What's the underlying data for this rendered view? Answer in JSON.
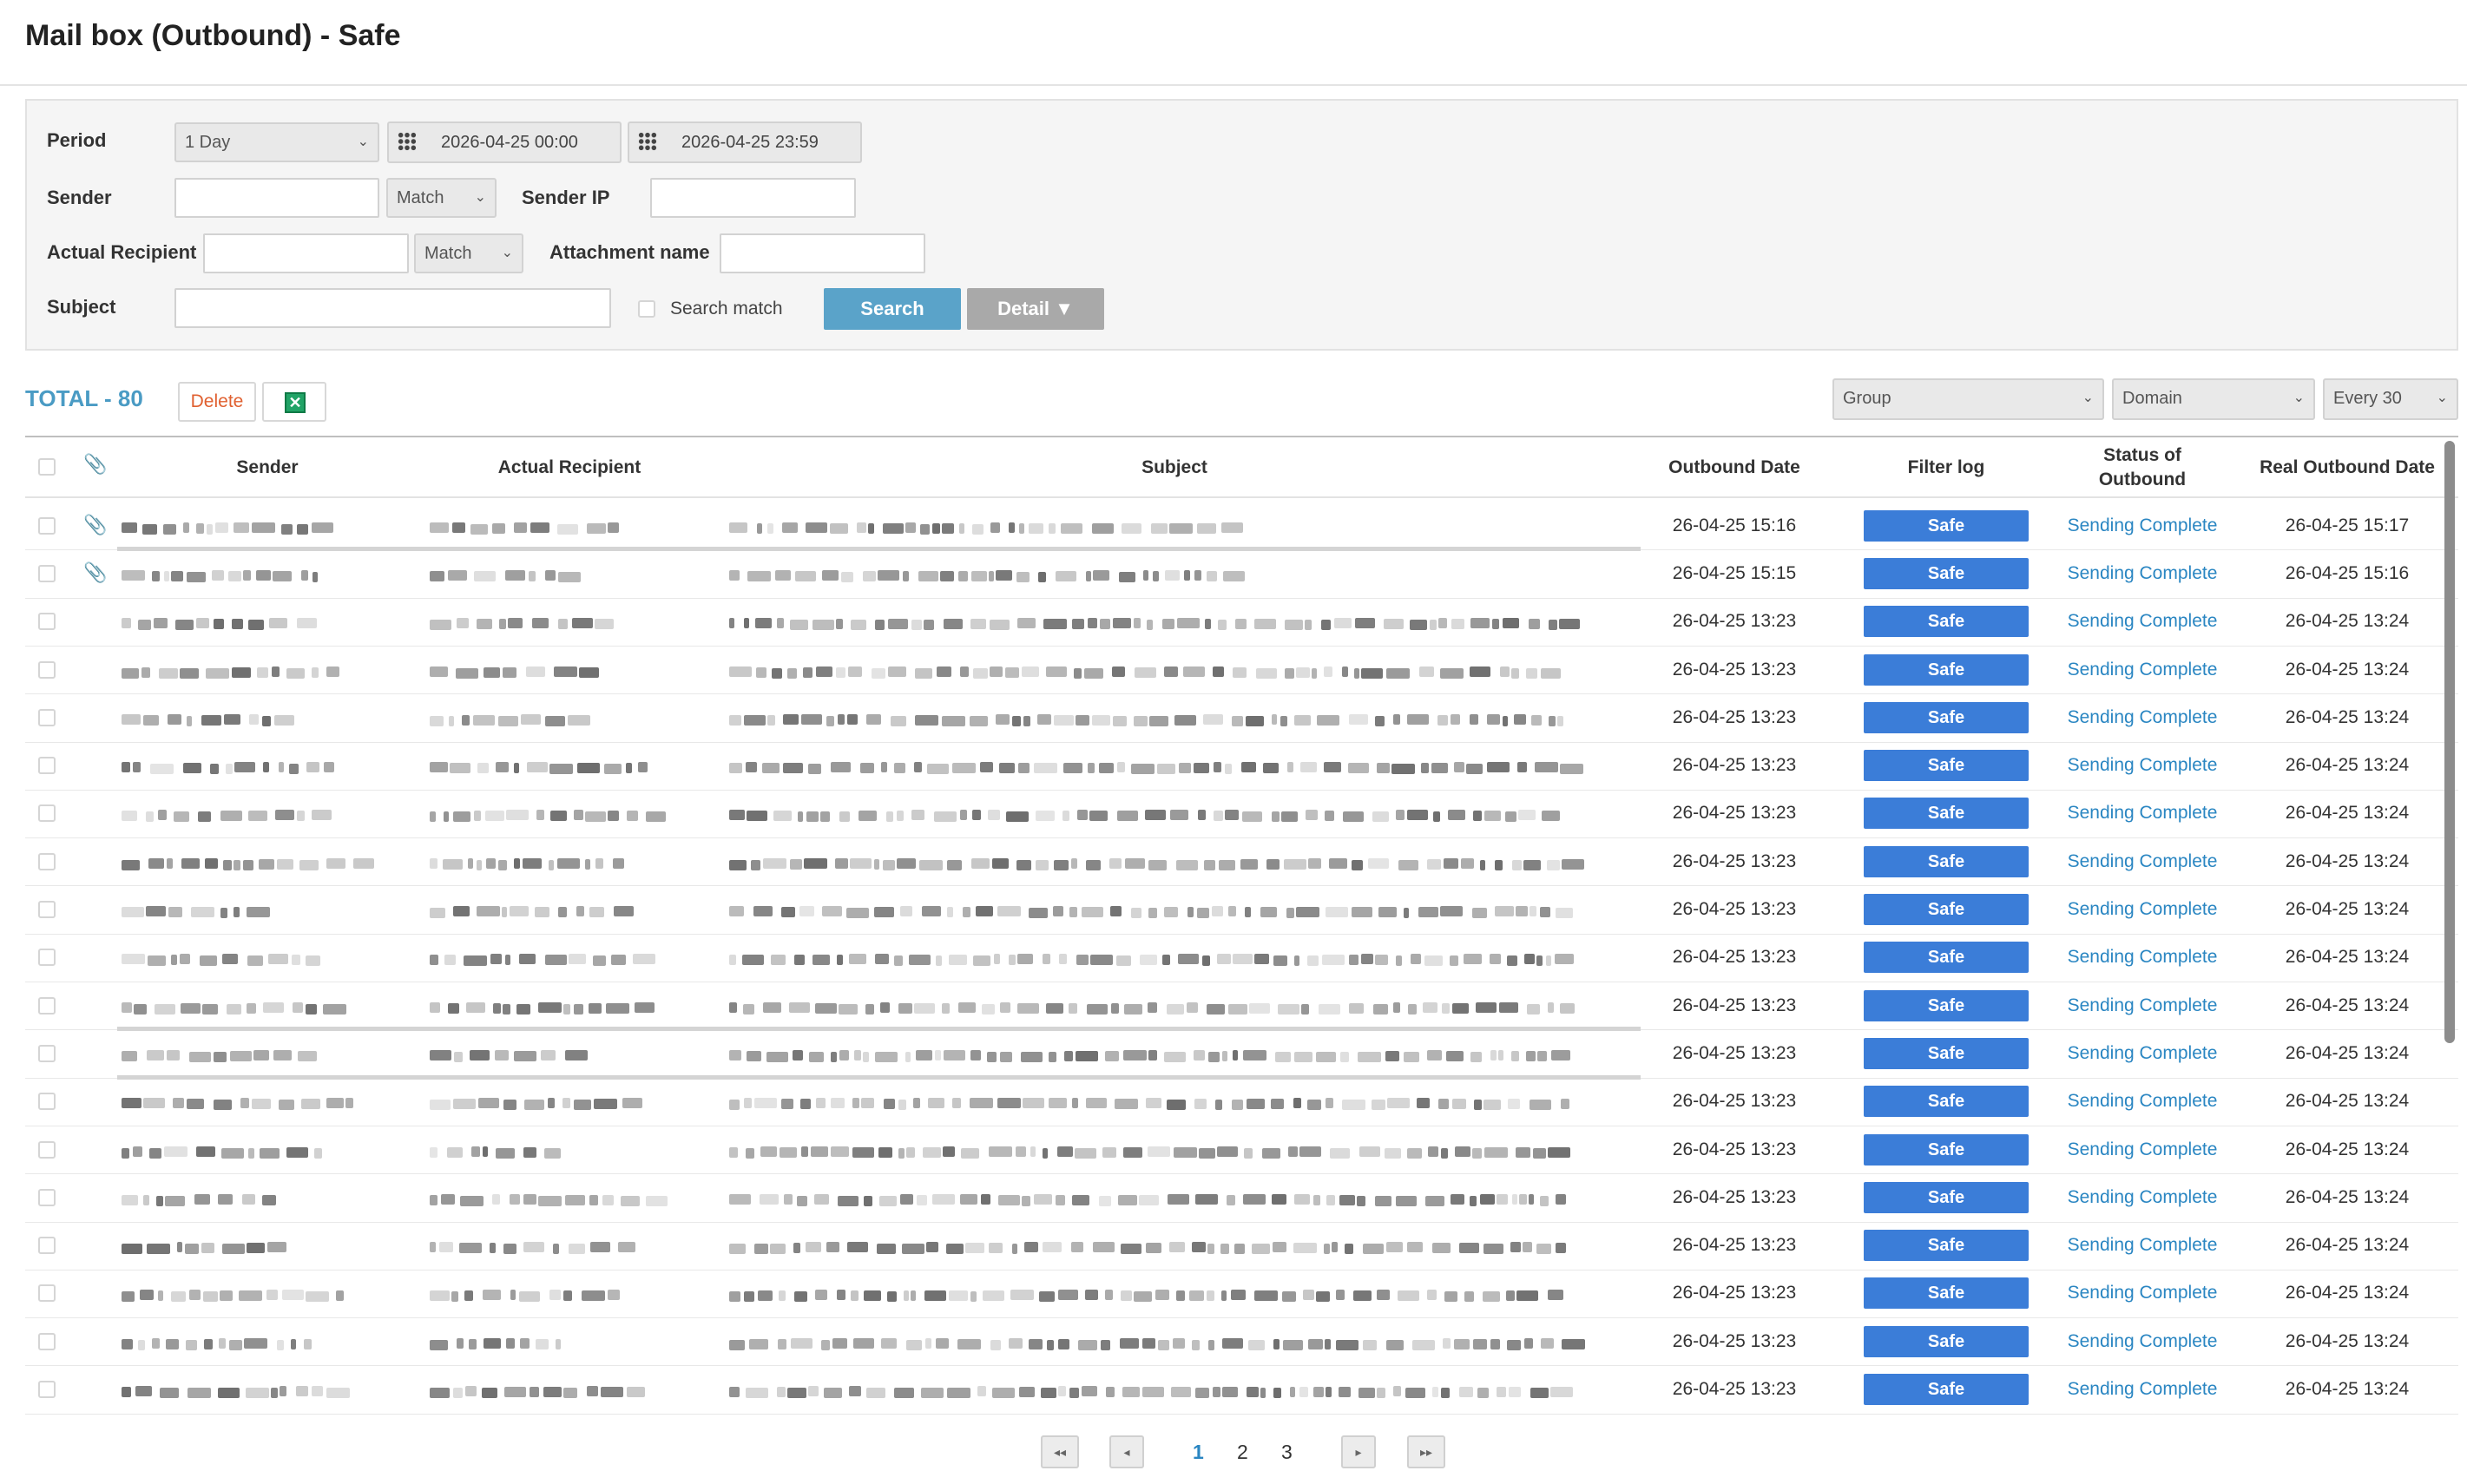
{
  "title": "Mail box (Outbound) - Safe",
  "filters": {
    "period_label": "Period",
    "period_value": "1 Day",
    "date_from": "2026-04-25 00:00",
    "date_to": "2026-04-25 23:59",
    "sender_label": "Sender",
    "sender_match": "Match",
    "sender_ip_label": "Sender IP",
    "recipient_label": "Actual Recipient",
    "recipient_match": "Match",
    "attachment_label": "Attachment name",
    "subject_label": "Subject",
    "search_match_label": "Search match",
    "search_button": "Search",
    "detail_button": "Detail ▼"
  },
  "toolbar": {
    "total": "TOTAL - 80",
    "delete_button": "Delete",
    "excel_icon": "excel-icon",
    "group_select": "Group",
    "domain_select": "Domain",
    "every_select": "Every 30"
  },
  "table": {
    "headers": {
      "sender": "Sender",
      "recipient": "Actual Recipient",
      "subject": "Subject",
      "outbound_date": "Outbound Date",
      "filter_log": "Filter log",
      "status_line1": "Status of",
      "status_line2": "Outbound",
      "real_date": "Real Outbound Date"
    },
    "rows": [
      {
        "attach": true,
        "date": "26-04-25 15:16",
        "filter": "Safe",
        "status": "Sending Complete",
        "real": "26-04-25 15:17"
      },
      {
        "attach": true,
        "date": "26-04-25 15:15",
        "filter": "Safe",
        "status": "Sending Complete",
        "real": "26-04-25 15:16"
      },
      {
        "attach": false,
        "date": "26-04-25 13:23",
        "filter": "Safe",
        "status": "Sending Complete",
        "real": "26-04-25 13:24"
      },
      {
        "attach": false,
        "date": "26-04-25 13:23",
        "filter": "Safe",
        "status": "Sending Complete",
        "real": "26-04-25 13:24"
      },
      {
        "attach": false,
        "date": "26-04-25 13:23",
        "filter": "Safe",
        "status": "Sending Complete",
        "real": "26-04-25 13:24"
      },
      {
        "attach": false,
        "date": "26-04-25 13:23",
        "filter": "Safe",
        "status": "Sending Complete",
        "real": "26-04-25 13:24"
      },
      {
        "attach": false,
        "date": "26-04-25 13:23",
        "filter": "Safe",
        "status": "Sending Complete",
        "real": "26-04-25 13:24"
      },
      {
        "attach": false,
        "date": "26-04-25 13:23",
        "filter": "Safe",
        "status": "Sending Complete",
        "real": "26-04-25 13:24"
      },
      {
        "attach": false,
        "date": "26-04-25 13:23",
        "filter": "Safe",
        "status": "Sending Complete",
        "real": "26-04-25 13:24"
      },
      {
        "attach": false,
        "date": "26-04-25 13:23",
        "filter": "Safe",
        "status": "Sending Complete",
        "real": "26-04-25 13:24"
      },
      {
        "attach": false,
        "date": "26-04-25 13:23",
        "filter": "Safe",
        "status": "Sending Complete",
        "real": "26-04-25 13:24"
      },
      {
        "attach": false,
        "date": "26-04-25 13:23",
        "filter": "Safe",
        "status": "Sending Complete",
        "real": "26-04-25 13:24"
      },
      {
        "attach": false,
        "date": "26-04-25 13:23",
        "filter": "Safe",
        "status": "Sending Complete",
        "real": "26-04-25 13:24"
      },
      {
        "attach": false,
        "date": "26-04-25 13:23",
        "filter": "Safe",
        "status": "Sending Complete",
        "real": "26-04-25 13:24"
      },
      {
        "attach": false,
        "date": "26-04-25 13:23",
        "filter": "Safe",
        "status": "Sending Complete",
        "real": "26-04-25 13:24"
      },
      {
        "attach": false,
        "date": "26-04-25 13:23",
        "filter": "Safe",
        "status": "Sending Complete",
        "real": "26-04-25 13:24"
      },
      {
        "attach": false,
        "date": "26-04-25 13:23",
        "filter": "Safe",
        "status": "Sending Complete",
        "real": "26-04-25 13:24"
      },
      {
        "attach": false,
        "date": "26-04-25 13:23",
        "filter": "Safe",
        "status": "Sending Complete",
        "real": "26-04-25 13:24"
      },
      {
        "attach": false,
        "date": "26-04-25 13:23",
        "filter": "Safe",
        "status": "Sending Complete",
        "real": "26-04-25 13:24"
      }
    ]
  },
  "pagination": {
    "first_icon": "double-left-icon",
    "prev_icon": "left-arrow-icon",
    "pages": [
      "1",
      "2",
      "3"
    ],
    "current": "1",
    "next_icon": "right-arrow-icon",
    "last_icon": "double-right-icon"
  }
}
